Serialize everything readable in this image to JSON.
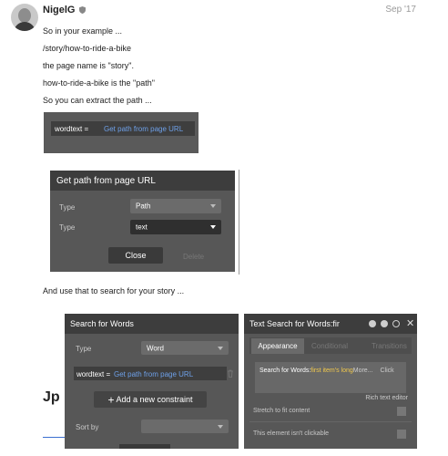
{
  "post": {
    "username": "NigelG",
    "date": "Sep '17",
    "paragraphs": [
      "So in your example ...",
      "/story/how-to-ride-a-bike",
      "the page name is \"story\".",
      "how-to-ride-a-bike is the \"path\"",
      "So you can extract the path ..."
    ],
    "after_text": "And use that to search for your story ..."
  },
  "screenshot1": {
    "label": "wordtext =",
    "value": "Get path from page URL"
  },
  "popup": {
    "title": "Get path from page URL",
    "rows": [
      {
        "label": "Type",
        "value": "Path"
      },
      {
        "label": "Type",
        "value": "text"
      }
    ],
    "close": "Close",
    "delete": "Delete"
  },
  "search_panel": {
    "title": "Search for Words",
    "type_label": "Type",
    "type_value": "Word",
    "constraint_label": "wordtext =",
    "constraint_value": "Get path from page URL",
    "add_constraint": "Add a new constraint",
    "sort_label": "Sort by"
  },
  "text_panel": {
    "title": "Text Search for Words:fir",
    "tabs": [
      "Appearance",
      "Conditional",
      "Transitions"
    ],
    "content_prefix": "Search for Words:",
    "content_highlight": "first item's long",
    "content_more": "More...",
    "content_click": "Click",
    "rich_text": "Rich text editor",
    "stretch": "Stretch to fit content",
    "not_clickable": "This element isn't clickable"
  },
  "overlay_text": "Jp"
}
